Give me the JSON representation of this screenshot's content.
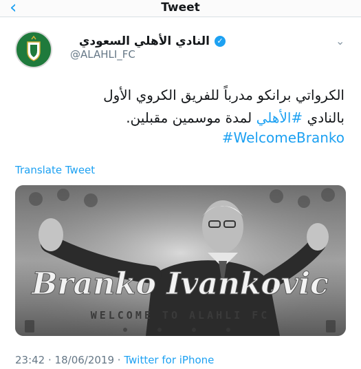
{
  "nav": {
    "back_icon": "‹",
    "title": "Tweet"
  },
  "user": {
    "display_name": "النادي الأهلي السعودي",
    "handle": "@ALAHLI_FC",
    "verified_icon": "✓"
  },
  "tweet": {
    "line1": "الكرواتي برانكو مدرباً للفريق الكروي الأول",
    "line2_prefix": "بالنادي ",
    "line2_hashtag": "#الأهلي",
    "line2_suffix": " لمدة موسمين مقبلين.",
    "hashtag_line": "#WelcomeBranko"
  },
  "translate_label": "Translate Tweet",
  "media": {
    "name_script": "Branko Ivankovic",
    "subtitle": "WELCOME TO ALAHLI FC"
  },
  "meta": {
    "time": "23:42",
    "date": "18/06/2019",
    "separator": " · ",
    "source": "Twitter for iPhone"
  }
}
